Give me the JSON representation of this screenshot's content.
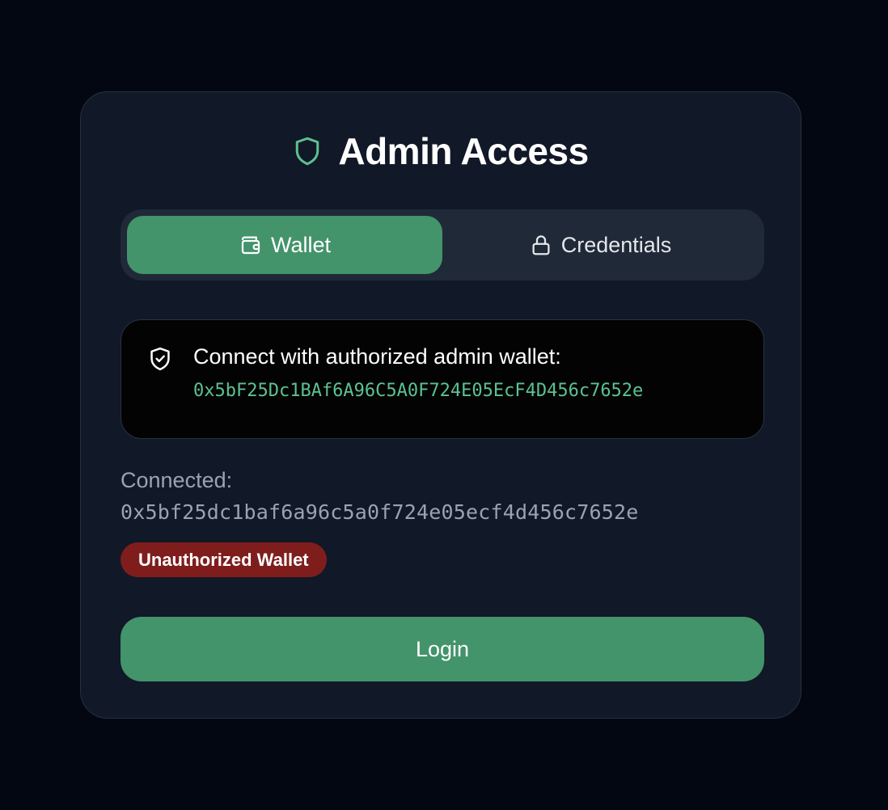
{
  "header": {
    "title": "Admin Access",
    "icon": "shield-icon",
    "accent_color": "#5cc292"
  },
  "tabs": [
    {
      "label": "Wallet",
      "icon": "wallet-icon",
      "active": true
    },
    {
      "label": "Credentials",
      "icon": "lock-icon",
      "active": false
    }
  ],
  "info": {
    "icon": "shield-check-icon",
    "text": "Connect with authorized admin wallet:",
    "authorized_address": "0x5bF25Dc1BAf6A96C5A0F724E05EcF4D456c7652e"
  },
  "connection": {
    "label": "Connected:",
    "address": "0x5bf25dc1baf6a96c5a0f724e05ecf4d456c7652e"
  },
  "status": {
    "badge_text": "Unauthorized Wallet",
    "badge_color": "#7f1d1d"
  },
  "actions": {
    "login_label": "Login",
    "primary_color": "#43936b"
  }
}
